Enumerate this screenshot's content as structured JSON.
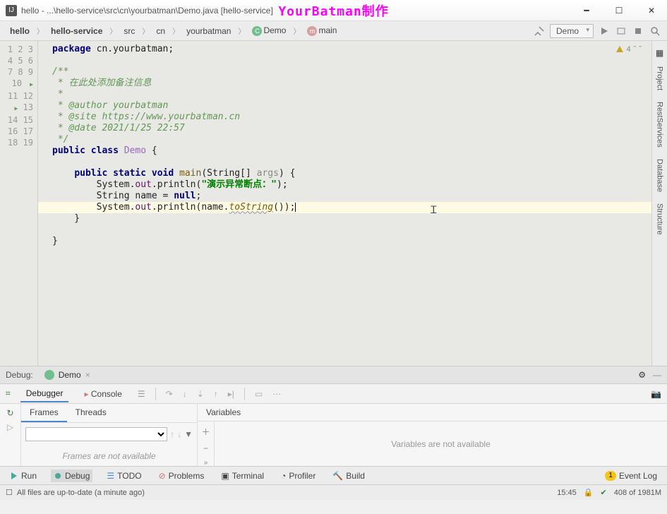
{
  "titlebar": {
    "title": "hello - ...\\hello-service\\src\\cn\\yourbatman\\Demo.java [hello-service]",
    "watermark": "YourBatman制作"
  },
  "breadcrumbs": [
    "hello",
    "hello-service",
    "src",
    "cn",
    "yourbatman",
    "Demo",
    "main"
  ],
  "run_config": "Demo",
  "editor_flags": {
    "warnings": "4"
  },
  "code_lines": [
    {
      "n": 1,
      "raw": "package cn.yourbatman;"
    },
    {
      "n": 2,
      "raw": ""
    },
    {
      "n": 3,
      "raw": "/**"
    },
    {
      "n": 4,
      "raw": " * 在此处添加备注信息"
    },
    {
      "n": 5,
      "raw": " *"
    },
    {
      "n": 6,
      "raw": " * @author yourbatman"
    },
    {
      "n": 7,
      "raw": " * @site https://www.yourbatman.cn"
    },
    {
      "n": 8,
      "raw": " * @date 2021/1/25 22:57"
    },
    {
      "n": 9,
      "raw": " */"
    },
    {
      "n": 10,
      "raw": "public class Demo {"
    },
    {
      "n": 11,
      "raw": ""
    },
    {
      "n": 12,
      "raw": "    public static void main(String[] args) {"
    },
    {
      "n": 13,
      "raw": "        System.out.println(\"演示异常断点：\");"
    },
    {
      "n": 14,
      "raw": "        String name = null;"
    },
    {
      "n": 15,
      "raw": "        System.out.println(name.toString());"
    },
    {
      "n": 16,
      "raw": "    }"
    },
    {
      "n": 17,
      "raw": ""
    },
    {
      "n": 18,
      "raw": "}"
    },
    {
      "n": 19,
      "raw": ""
    }
  ],
  "right_tools": [
    "Project",
    "RestServices",
    "Database",
    "Structure"
  ],
  "debug": {
    "label": "Debug:",
    "tab": "Demo",
    "tabs": {
      "debugger": "Debugger",
      "console": "Console"
    },
    "frames": {
      "tab_frames": "Frames",
      "tab_threads": "Threads",
      "empty": "Frames are not available"
    },
    "variables": {
      "header": "Variables",
      "empty": "Variables are not available"
    }
  },
  "toolwins": {
    "run": "Run",
    "debug": "Debug",
    "todo": "TODO",
    "problems": "Problems",
    "terminal": "Terminal",
    "profiler": "Profiler",
    "build": "Build",
    "eventlog": "Event Log",
    "event_count": "1"
  },
  "statusbar": {
    "msg": "All files are up-to-date (a minute ago)",
    "pos": "15:45",
    "mem": "408 of 1981M"
  }
}
